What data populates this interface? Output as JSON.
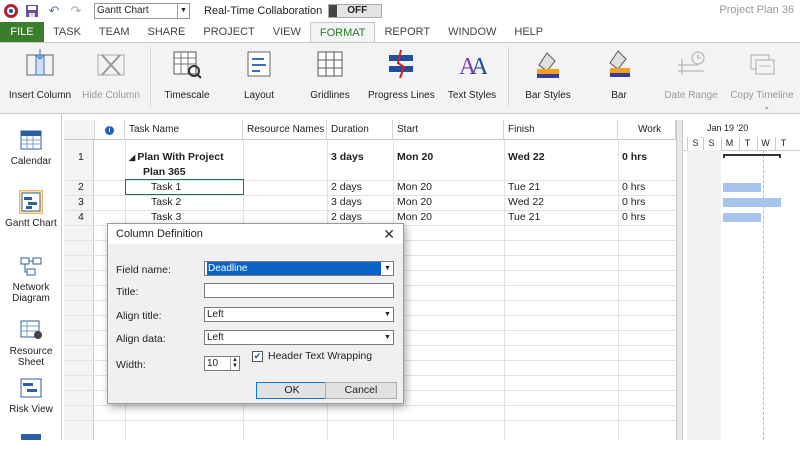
{
  "qat": {
    "view_select": "Gantt Chart",
    "rtc_label": "Real-Time Collaboration",
    "toggle": "OFF",
    "window_title": "Project Plan 36"
  },
  "tabs": [
    "FILE",
    "TASK",
    "TEAM",
    "SHARE",
    "PROJECT",
    "VIEW",
    "FORMAT",
    "REPORT",
    "WINDOW",
    "HELP"
  ],
  "ribbon": {
    "insert_column": "Insert Column",
    "hide_column": "Hide Column",
    "timescale": "Timescale",
    "layout": "Layout",
    "gridlines": "Gridlines",
    "progress_lines": "Progress Lines",
    "text_styles": "Text Styles",
    "bar_styles": "Bar Styles",
    "bar": "Bar",
    "date_range": "Date Range",
    "copy_timeline": "Copy Timeline"
  },
  "sidebar": {
    "calendar": "Calendar",
    "gantt": "Gantt Chart",
    "network": "Network Diagram",
    "resource": "Resource Sheet",
    "risk": "Risk View"
  },
  "grid": {
    "headers": {
      "info": "i",
      "task": "Task Name",
      "resource": "Resource Names",
      "duration": "Duration",
      "start": "Start",
      "finish": "Finish",
      "work": "Work"
    },
    "rows": [
      {
        "num": "1",
        "task": "Plan With Project",
        "task2": "Plan 365",
        "duration": "3 days",
        "start": "Mon 20",
        "finish": "Wed 22",
        "work": "0 hrs"
      },
      {
        "num": "2",
        "task": "Task 1",
        "duration": "2 days",
        "start": "Mon 20",
        "finish": "Tue 21",
        "work": "0 hrs"
      },
      {
        "num": "3",
        "task": "Task 2",
        "duration": "3 days",
        "start": "Mon 20",
        "finish": "Wed 22",
        "work": "0 hrs"
      },
      {
        "num": "4",
        "task": "Task 3",
        "duration": "2 days",
        "start": "Mon 20",
        "finish": "Tue 21",
        "work": "0 hrs"
      }
    ]
  },
  "gantt": {
    "date": "Jan 19 '20",
    "days": [
      "S",
      "S",
      "M",
      "T",
      "W",
      "T"
    ]
  },
  "dialog": {
    "title": "Column Definition",
    "field_name_label": "Field name:",
    "field_name_value": "Deadline",
    "title_label": "Title:",
    "title_value": "",
    "align_title_label": "Align title:",
    "align_title_value": "Left",
    "align_data_label": "Align data:",
    "align_data_value": "Left",
    "width_label": "Width:",
    "width_value": "10",
    "wrap_label": "Header Text Wrapping",
    "ok": "OK",
    "cancel": "Cancel"
  }
}
